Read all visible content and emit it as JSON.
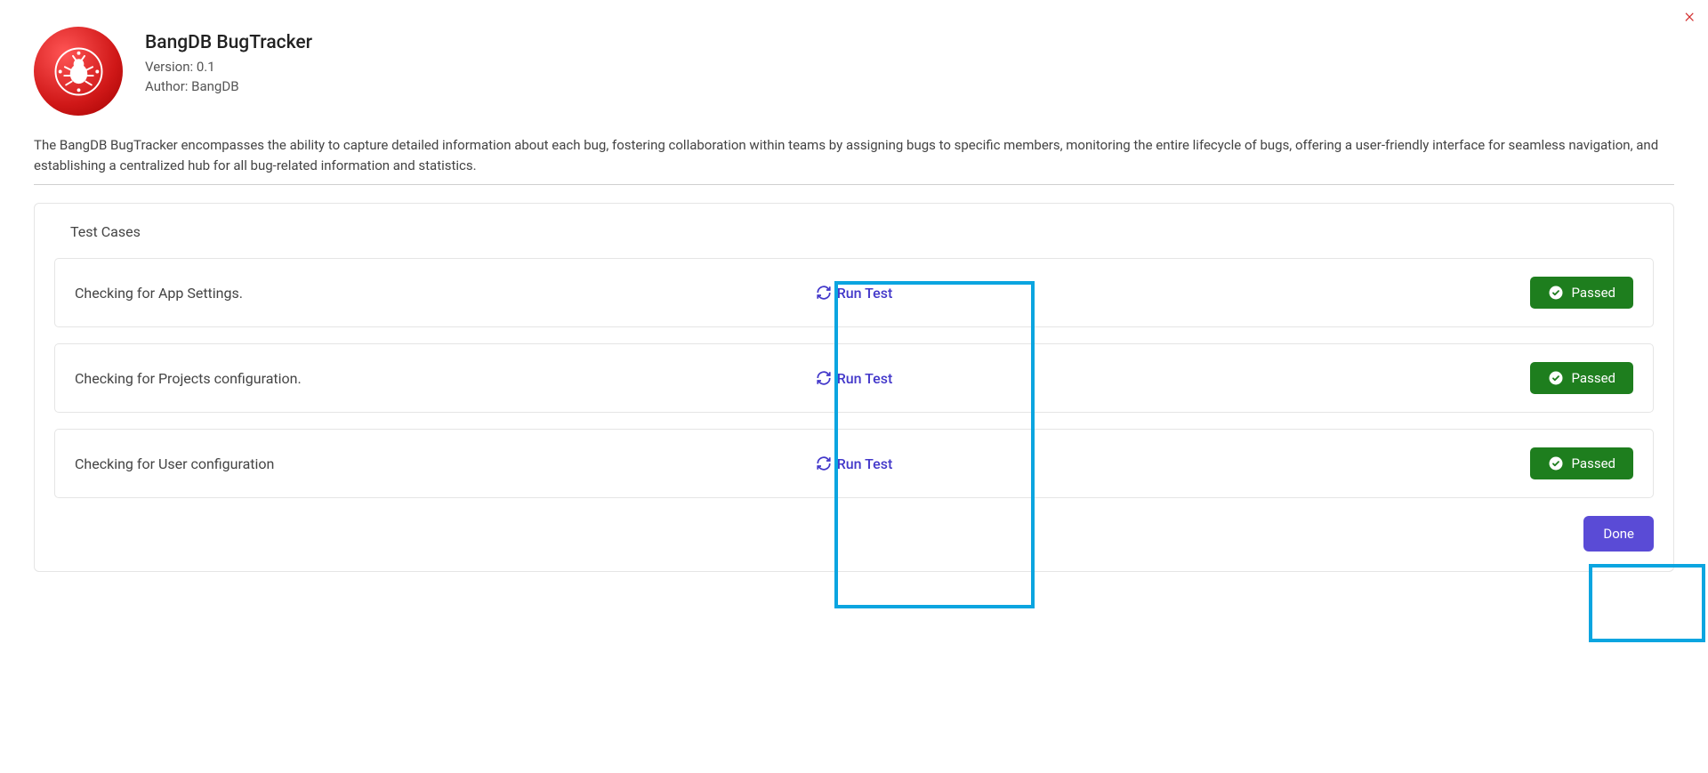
{
  "close_label": "×",
  "app": {
    "title": "BangDB BugTracker",
    "version": "Version: 0.1",
    "author": "Author: BangDB",
    "description": "The BangDB BugTracker encompasses the ability to capture detailed information about each bug, fostering collaboration within teams by assigning bugs to specific members, monitoring the entire lifecycle of bugs, offering a user-friendly interface for seamless navigation, and establishing a centralized hub for all bug-related information and statistics."
  },
  "panel": {
    "title": "Test Cases",
    "tests": [
      {
        "name": "Checking for App Settings.",
        "run_label": "Run Test",
        "status": "Passed"
      },
      {
        "name": "Checking for Projects configuration.",
        "run_label": "Run Test",
        "status": "Passed"
      },
      {
        "name": "Checking for User configuration",
        "run_label": "Run Test",
        "status": "Passed"
      }
    ],
    "done_label": "Done"
  }
}
